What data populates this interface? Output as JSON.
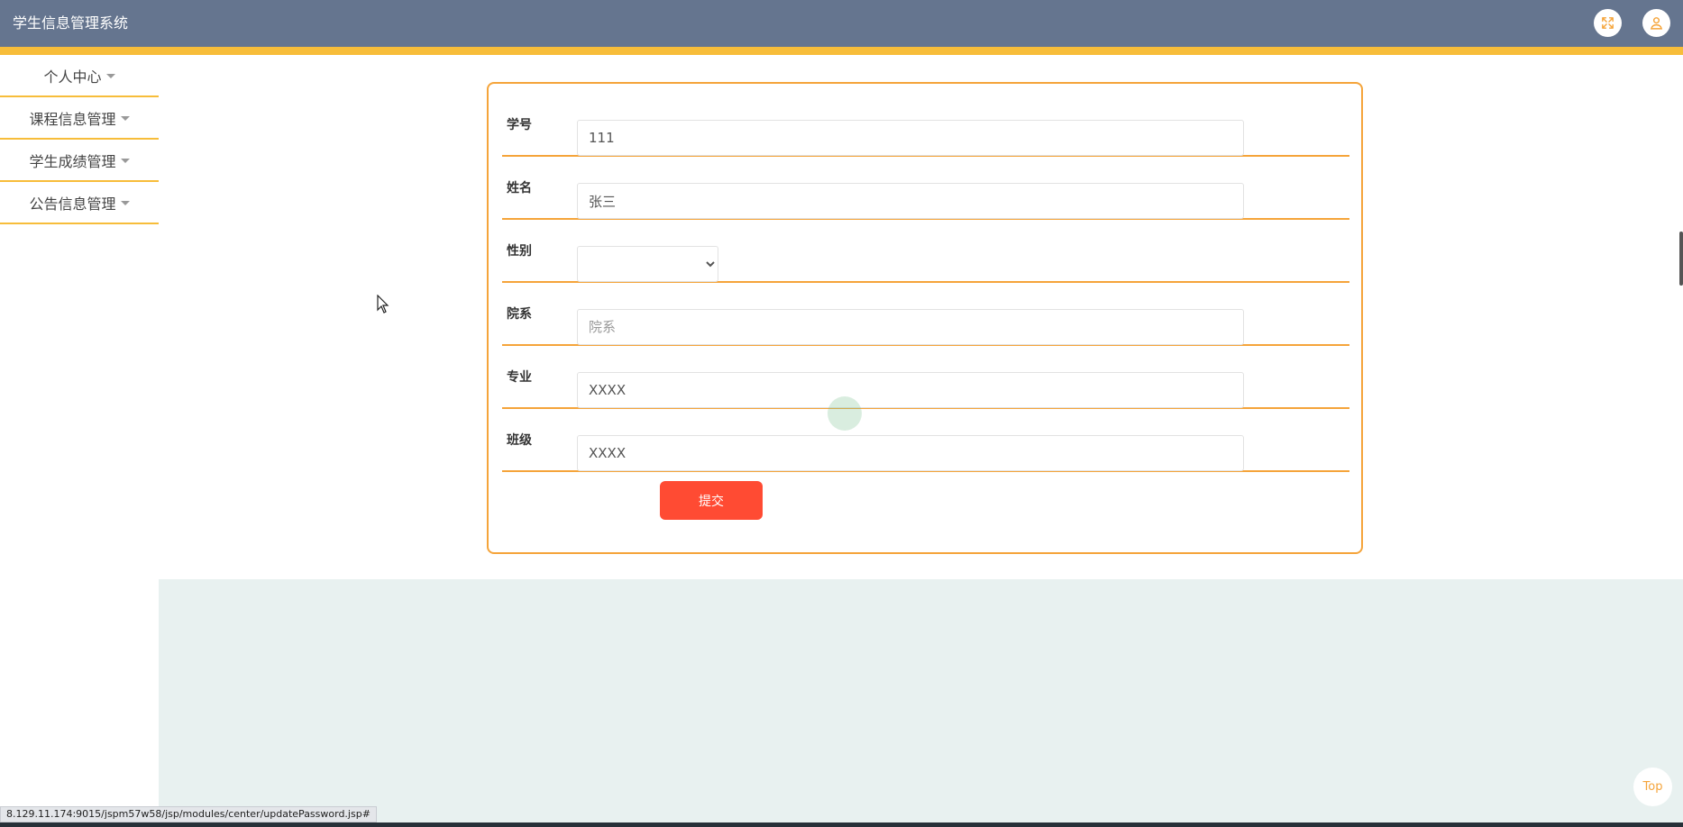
{
  "app": {
    "title": "学生信息管理系统"
  },
  "header": {
    "fullscreen_icon": "fullscreen-icon",
    "user_icon": "user-icon"
  },
  "sidebar": {
    "items": [
      {
        "label": "个人中心"
      },
      {
        "label": "课程信息管理"
      },
      {
        "label": "学生成绩管理"
      },
      {
        "label": "公告信息管理"
      }
    ]
  },
  "form": {
    "fields": [
      {
        "label": "学号",
        "value": "111",
        "placeholder": ""
      },
      {
        "label": "姓名",
        "value": "张三",
        "placeholder": ""
      },
      {
        "label": "性别",
        "value": "",
        "placeholder": ""
      },
      {
        "label": "院系",
        "value": "",
        "placeholder": "院系"
      },
      {
        "label": "专业",
        "value": "XXXX",
        "placeholder": ""
      },
      {
        "label": "班级",
        "value": "XXXX",
        "placeholder": ""
      }
    ],
    "submit_label": "提交"
  },
  "top_button": {
    "label": "Top"
  },
  "status_bar": {
    "url": "8.129.11.174:9015/jspm57w58/jsp/modules/center/updatePassword.jsp#"
  },
  "colors": {
    "header_bg": "#65758f",
    "accent_yellow": "#f7bd3a",
    "accent_orange": "#f5a43a",
    "submit_red": "#ff4b33",
    "footer_bg": "#e8f1f0"
  }
}
